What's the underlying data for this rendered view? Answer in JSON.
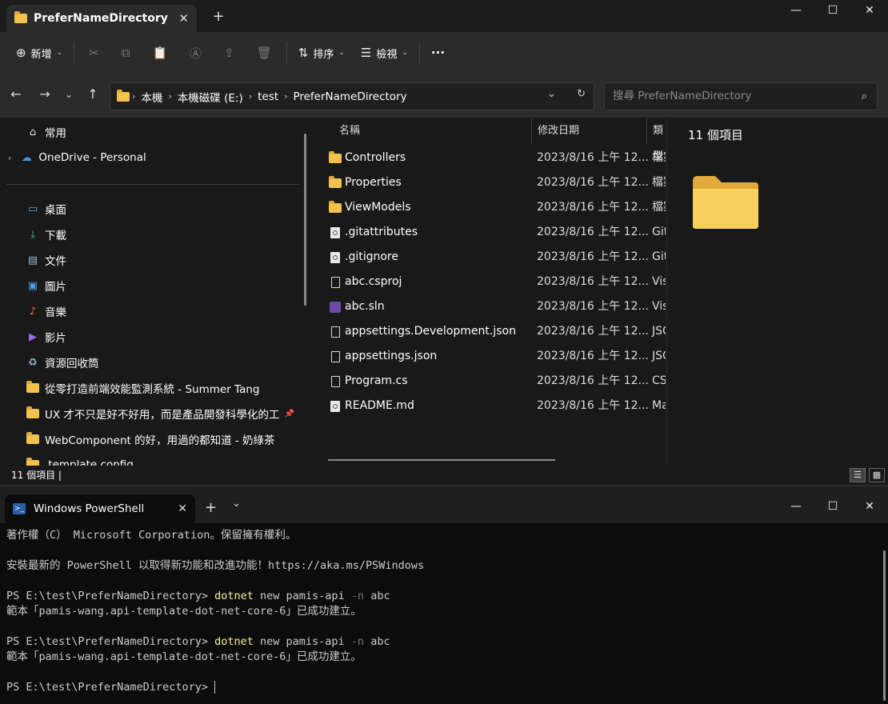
{
  "explorer": {
    "tab_title": "PreferNameDirectory",
    "tab_close": "✕",
    "new_tab": "+",
    "window_controls": {
      "minimize": "—",
      "maximize": "☐",
      "close": "✕"
    },
    "toolbar": {
      "new_label": "新增",
      "sort_label": "排序",
      "view_label": "檢視",
      "more_label": "···"
    },
    "address": {
      "crumbs": [
        "本機",
        "本機磁碟 (E:)",
        "test",
        "PreferNameDirectory"
      ]
    },
    "search": {
      "placeholder": "搜尋 PreferNameDirectory"
    },
    "nav": {
      "home": "常用",
      "onedrive": "OneDrive - Personal",
      "quick": [
        {
          "label": "桌面",
          "icon": "desktop-icon"
        },
        {
          "label": "下載",
          "icon": "download-icon"
        },
        {
          "label": "文件",
          "icon": "documents-icon"
        },
        {
          "label": "圖片",
          "icon": "pictures-icon"
        },
        {
          "label": "音樂",
          "icon": "music-icon"
        },
        {
          "label": "影片",
          "icon": "videos-icon"
        },
        {
          "label": "資源回收筒",
          "icon": "recycle-bin-icon"
        },
        {
          "label": "從零打造前端效能監測系統 - Summer Tang",
          "icon": "folder-icon"
        },
        {
          "label": "UX 才不只是好不好用，而是產品開發科學化的工",
          "icon": "folder-icon"
        },
        {
          "label": "WebComponent 的好，用過的都知道 - 奶綠茶",
          "icon": "folder-icon"
        },
        {
          "label": ".template.config",
          "icon": "folder-icon"
        }
      ]
    },
    "columns": {
      "name": "名稱",
      "date": "修改日期",
      "type": "類型"
    },
    "files": [
      {
        "name": "Controllers",
        "date": "2023/8/16 上午 12...",
        "type": "檔案",
        "icon": "folder"
      },
      {
        "name": "Properties",
        "date": "2023/8/16 上午 12...",
        "type": "檔案",
        "icon": "folder"
      },
      {
        "name": "ViewModels",
        "date": "2023/8/16 上午 12...",
        "type": "檔案",
        "icon": "folder"
      },
      {
        "name": ".gitattributes",
        "date": "2023/8/16 上午 12...",
        "type": "Git",
        "icon": "gear"
      },
      {
        "name": ".gitignore",
        "date": "2023/8/16 上午 12...",
        "type": "Git",
        "icon": "gear"
      },
      {
        "name": "abc.csproj",
        "date": "2023/8/16 上午 12...",
        "type": "Vis",
        "icon": "file"
      },
      {
        "name": "abc.sln",
        "date": "2023/8/16 上午 12...",
        "type": "Vis",
        "icon": "sln"
      },
      {
        "name": "appsettings.Development.json",
        "date": "2023/8/16 上午 12...",
        "type": "JSC",
        "icon": "file"
      },
      {
        "name": "appsettings.json",
        "date": "2023/8/16 上午 12...",
        "type": "JSC",
        "icon": "file"
      },
      {
        "name": "Program.cs",
        "date": "2023/8/16 上午 12...",
        "type": "CS",
        "icon": "file"
      },
      {
        "name": "README.md",
        "date": "2023/8/16 上午 12...",
        "type": "Ma",
        "icon": "gear"
      }
    ],
    "preview_count": "11 個項目",
    "status_text": "11 個項目  |"
  },
  "terminal": {
    "tab_title": "Windows PowerShell",
    "tab_close": "✕",
    "new_tab": "+",
    "dropdown": "⌄",
    "window_controls": {
      "minimize": "—",
      "maximize": "☐",
      "close": "✕"
    },
    "lines": {
      "copyright": "著作權（C） Microsoft Corporation。保留擁有權利。",
      "install": "安裝最新的 PowerShell 以取得新功能和改進功能！https://aka.ms/PSWindows",
      "prompt": "PS E:\\test\\PreferNameDirectory> ",
      "cmd_word": "dotnet",
      "cmd_rest1": " new pamis-api ",
      "cmd_flag": "-n",
      "cmd_rest2": " abc",
      "result": "範本「pamis-wang.api-template-dot-net-core-6」已成功建立。"
    }
  }
}
